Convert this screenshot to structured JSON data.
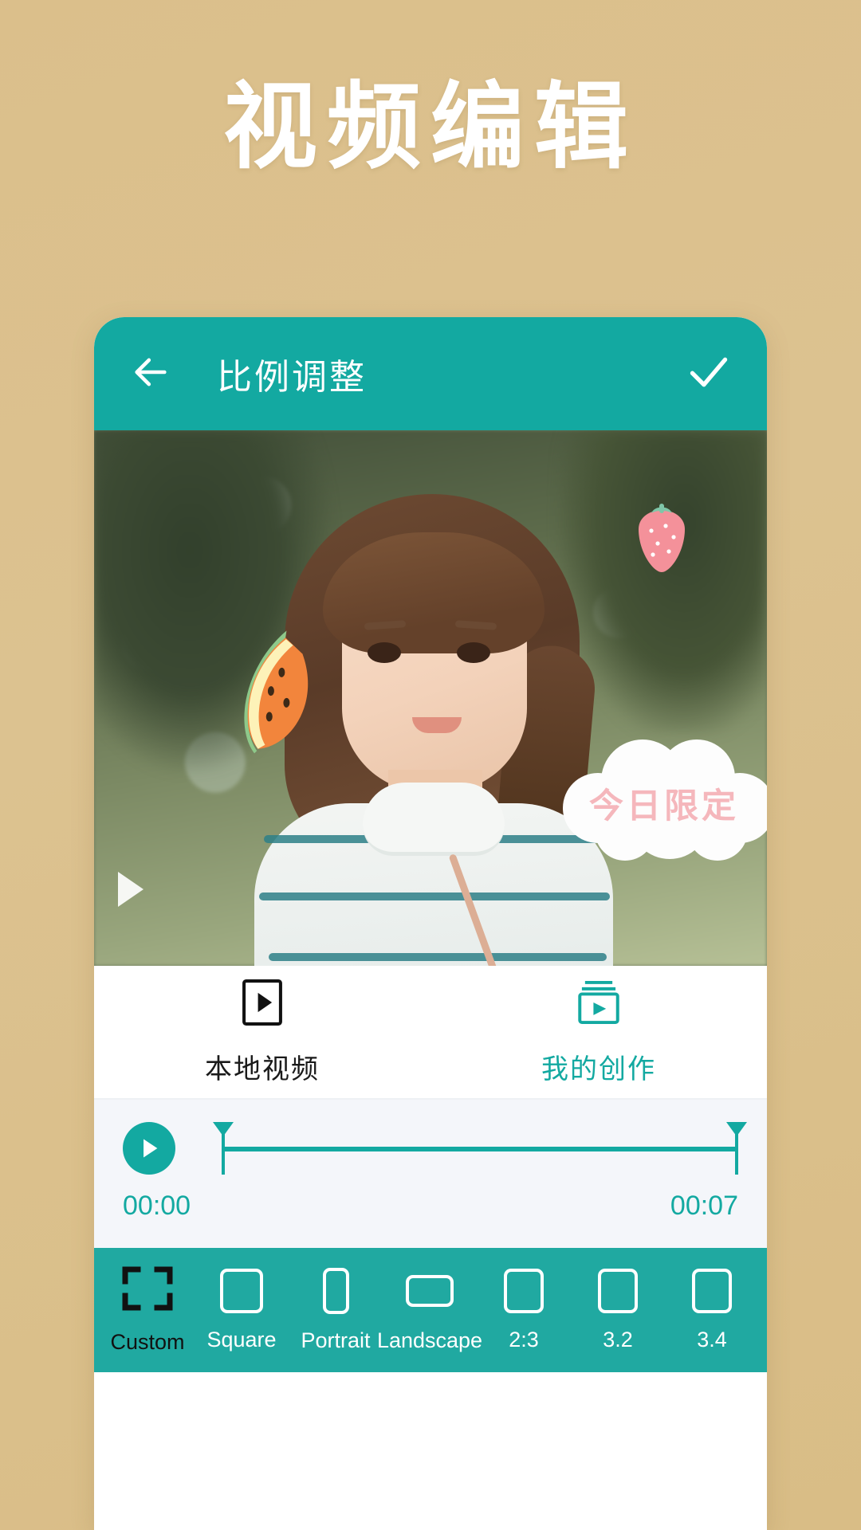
{
  "promo": {
    "title": "视频编辑"
  },
  "theme": {
    "background": "#dcc08c",
    "accent_teal": "#13a9a1",
    "ratio_bar_teal": "#20a9a1",
    "sticker_pink": "#f5b7bc"
  },
  "appbar": {
    "back_icon": "arrow-left-icon",
    "title": "比例调整",
    "confirm_icon": "check-icon"
  },
  "preview": {
    "play_overlay_icon": "play-triangle-icon",
    "stickers": [
      {
        "name": "strawberry-sticker",
        "label": "strawberry"
      },
      {
        "name": "watermelon-sticker",
        "label": "watermelon"
      },
      {
        "name": "cloud-text-sticker",
        "text": "今日限定"
      }
    ]
  },
  "source_tabs": [
    {
      "label": "本地视频",
      "icon": "video-file-icon",
      "active": true
    },
    {
      "label": "我的创作",
      "icon": "stacked-video-icon",
      "active": false
    }
  ],
  "timeline": {
    "play_icon": "play-circle-icon",
    "start_time": "00:00",
    "end_time": "00:07"
  },
  "ratio_bar": {
    "items": [
      {
        "label": "Custom",
        "shape": "custom-brackets",
        "selected": true
      },
      {
        "label": "Square",
        "shape": "square",
        "selected": false
      },
      {
        "label": "Portrait",
        "shape": "portrait",
        "selected": false
      },
      {
        "label": "Landscape",
        "shape": "landscape",
        "selected": false
      },
      {
        "label": "2:3",
        "shape": "square",
        "selected": false
      },
      {
        "label": "3.2",
        "shape": "square",
        "selected": false
      },
      {
        "label": "3.4",
        "shape": "square",
        "selected": false
      }
    ]
  }
}
